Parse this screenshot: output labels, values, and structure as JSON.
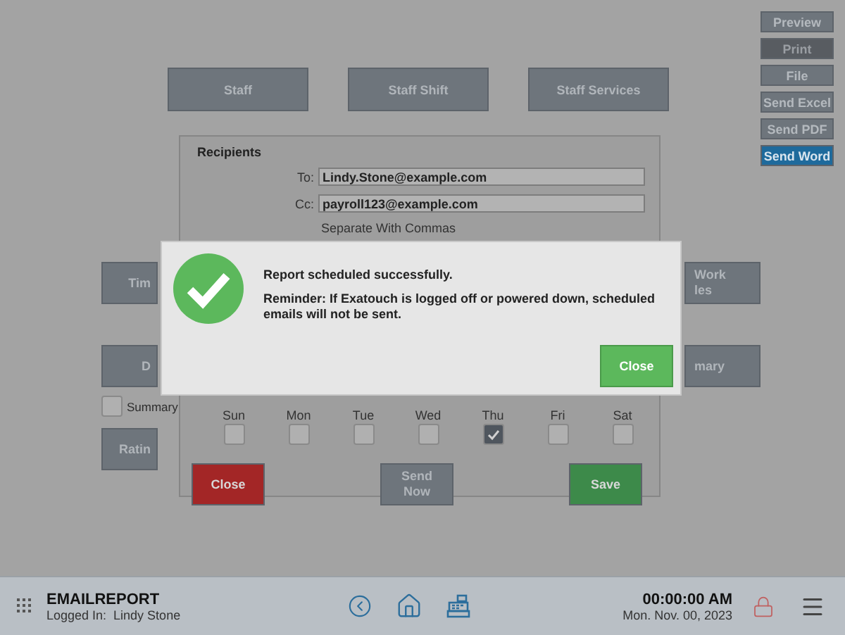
{
  "sidebar_buttons": [
    {
      "label": "Preview",
      "disabled": false,
      "selected": false
    },
    {
      "label": "Print",
      "disabled": true,
      "selected": false
    },
    {
      "label": "File",
      "disabled": false,
      "selected": false
    },
    {
      "label": "Send Excel",
      "disabled": false,
      "selected": false
    },
    {
      "label": "Send PDF",
      "disabled": false,
      "selected": false
    },
    {
      "label": "Send Word",
      "disabled": false,
      "selected": true
    }
  ],
  "report_buttons": [
    "Staff",
    "Staff Shift",
    "Staff Services"
  ],
  "left_column": [
    {
      "kind": "button",
      "label": "Tim"
    },
    {
      "kind": "button",
      "label": "D"
    },
    {
      "kind": "checkbox",
      "label": "Summary",
      "checked": false
    },
    {
      "kind": "button",
      "label": "Ratin"
    }
  ],
  "right_column": [
    {
      "lines": [
        "Work",
        "les"
      ]
    },
    {
      "lines": [
        "mary"
      ]
    }
  ],
  "email_dialog": {
    "section": "Recipients",
    "to_label": "To:",
    "to_value": "Lindy.Stone@example.com",
    "cc_label": "Cc:",
    "cc_value": "payroll123@example.com",
    "hint": "Separate With Commas",
    "days": [
      {
        "label": "Sun",
        "checked": false
      },
      {
        "label": "Mon",
        "checked": false
      },
      {
        "label": "Tue",
        "checked": false
      },
      {
        "label": "Wed",
        "checked": false
      },
      {
        "label": "Thu",
        "checked": true
      },
      {
        "label": "Fri",
        "checked": false
      },
      {
        "label": "Sat",
        "checked": false
      }
    ],
    "buttons": [
      {
        "kind": "cancel",
        "lines": [
          "Close"
        ]
      },
      {
        "kind": "neutral",
        "lines": [
          "Send",
          "Now"
        ]
      },
      {
        "kind": "confirm",
        "lines": [
          "Save"
        ]
      }
    ]
  },
  "modal": {
    "title": "Report scheduled successfully.",
    "message": "Reminder: If Exatouch is logged off or powered down, scheduled emails will not be sent.",
    "button": "Close"
  },
  "status_bar": {
    "screen": "EMAILREPORT",
    "logged_in": "Logged In:  Lindy Stone",
    "time": "00:00:00 AM",
    "date": "Mon. Nov. 00, 2023"
  }
}
